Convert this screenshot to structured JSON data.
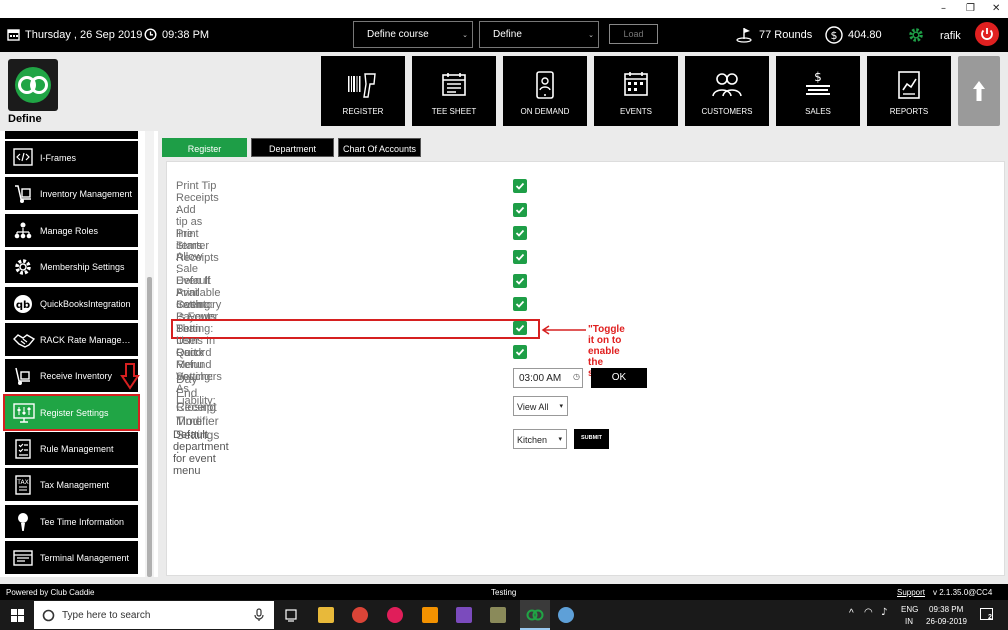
{
  "window": {
    "minimize": "–",
    "restore": "❐",
    "close": "✕"
  },
  "topbar": {
    "date": "Thursday ,  26 Sep 2019",
    "time": "09:38 PM",
    "course_select": "Define course",
    "define_select": "Define",
    "load_button": "Load",
    "rounds": "77 Rounds",
    "balance": "404.80",
    "user": "rafik"
  },
  "brand": {
    "name": "Define"
  },
  "nav": [
    {
      "label": "REGISTER",
      "icon": "barcode-scanner-icon"
    },
    {
      "label": "TEE SHEET",
      "icon": "calendar-sheet-icon"
    },
    {
      "label": "ON DEMAND",
      "icon": "mobile-user-icon"
    },
    {
      "label": "EVENTS",
      "icon": "events-calendar-icon"
    },
    {
      "label": "CUSTOMERS",
      "icon": "customers-icon"
    },
    {
      "label": "SALES",
      "icon": "sales-icon"
    },
    {
      "label": "REPORTS",
      "icon": "reports-icon"
    }
  ],
  "sidebar": {
    "items": [
      {
        "label": "I-Frames"
      },
      {
        "label": "Inventory Management"
      },
      {
        "label": "Manage Roles"
      },
      {
        "label": "Membership Settings"
      },
      {
        "label": "QuickBooksIntegration"
      },
      {
        "label": "RACK Rate Manageme..."
      },
      {
        "label": "Receive Inventory"
      },
      {
        "label": "Register Settings"
      },
      {
        "label": "Rule Management"
      },
      {
        "label": "Tax Management"
      },
      {
        "label": "Tee Time Information"
      },
      {
        "label": "Terminal Management"
      }
    ]
  },
  "tabs": {
    "register": "Register",
    "department": "Department",
    "chart": "Chart Of Accounts"
  },
  "settings": [
    {
      "label": "Print Tip Receipts :",
      "checked": true
    },
    {
      "label": "Add tip as line items :",
      "checked": true
    },
    {
      "label": "Print Starter Receipts :",
      "checked": true
    },
    {
      "label": "Allow Sale Even If Available Inventory Is Fewer Than Items In Cart :",
      "checked": true
    },
    {
      "label": "Default Print Setting:",
      "checked": true
    },
    {
      "label": "Cash Payouts Setting:",
      "checked": true
    },
    {
      "label": "Per User Quick Menu Setting:",
      "checked": true
    },
    {
      "label": "Record Refund Vouchers As Liability:",
      "checked": true
    }
  ],
  "day_end": {
    "label": "Day End Closing Time :",
    "value": "03:00 AM",
    "ok": "OK"
  },
  "receipt_modifier": {
    "label": "Receipt Modifier Settings :",
    "value": "View All"
  },
  "default_dept": {
    "label": "Default department for event menu",
    "value": "Kitchen",
    "submit": "SUBMIT"
  },
  "annotation": "\"Toggle it on to enable the setting\"",
  "footer": {
    "powered": "Powered by Club Caddie",
    "env": "Testing",
    "support": "Support",
    "version": "v 2.1.35.0@CC4"
  },
  "taskbar": {
    "search_placeholder": "Type here to search",
    "lang1": "ENG",
    "lang2": "IN",
    "clock_time": "09:38 PM",
    "clock_date": "26-09-2019",
    "notif_count": "2"
  },
  "colors": {
    "accent": "#1e9e47",
    "annotation": "#d62020",
    "power": "#e02020"
  }
}
